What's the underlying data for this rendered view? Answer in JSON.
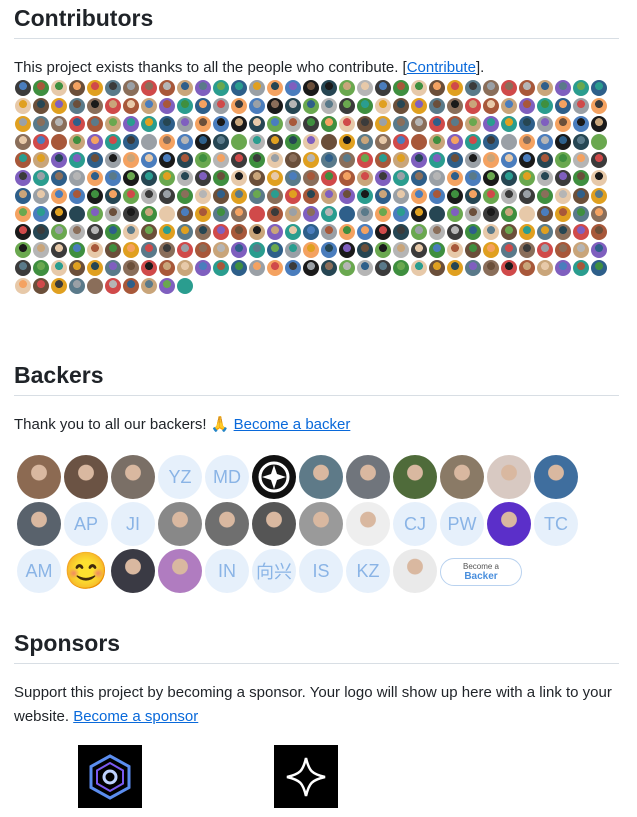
{
  "contributors": {
    "title": "Contributors",
    "text": "This project exists thanks to all the people who contribute. [",
    "link": "Contribute",
    "text_end": "].",
    "avatar_count": 373
  },
  "backers": {
    "title": "Backers",
    "text": "Thank you to all our backers! 🙏 ",
    "link": "Become a backer",
    "items": [
      {
        "type": "photo",
        "color": "#8c6a52"
      },
      {
        "type": "photo",
        "color": "#6b5344"
      },
      {
        "type": "photo",
        "color": "#7a6f66"
      },
      {
        "type": "initials",
        "text": "YZ"
      },
      {
        "type": "initials",
        "text": "MD"
      },
      {
        "type": "logo",
        "color": "#111111"
      },
      {
        "type": "photo",
        "color": "#5e7a88"
      },
      {
        "type": "photo",
        "color": "#70757c"
      },
      {
        "type": "photo",
        "color": "#4f6b3a"
      },
      {
        "type": "photo",
        "color": "#8a7a66"
      },
      {
        "type": "photo",
        "color": "#d8c9c2"
      },
      {
        "type": "photo",
        "color": "#3f6e9e"
      },
      {
        "type": "photo",
        "color": "#59626c"
      },
      {
        "type": "initials",
        "text": "AP"
      },
      {
        "type": "initials",
        "text": "JI"
      },
      {
        "type": "photo",
        "color": "#888888"
      },
      {
        "type": "photo",
        "color": "#6f6f6f"
      },
      {
        "type": "photo",
        "color": "#555555"
      },
      {
        "type": "photo",
        "color": "#9a9a9a"
      },
      {
        "type": "photo",
        "color": "#eeeeee"
      },
      {
        "type": "initials",
        "text": "CJ"
      },
      {
        "type": "initials",
        "text": "PW"
      },
      {
        "type": "photo",
        "color": "#5b2fc9"
      },
      {
        "type": "initials",
        "text": "TC"
      },
      {
        "type": "initials",
        "text": "AM"
      },
      {
        "type": "emoji",
        "text": "😊"
      },
      {
        "type": "photo",
        "color": "#3a3a44"
      },
      {
        "type": "photo",
        "color": "#b07cc0"
      },
      {
        "type": "initials",
        "text": "IN"
      },
      {
        "type": "initials",
        "text": "向兴"
      },
      {
        "type": "initials",
        "text": "IS"
      },
      {
        "type": "initials",
        "text": "KZ"
      },
      {
        "type": "photo",
        "color": "#eaeaea"
      }
    ],
    "button_line1": "Become a",
    "button_line2": "Backer"
  },
  "sponsors": {
    "title": "Sponsors",
    "text": "Support this project by becoming a sponsor. Your logo will show up here with a link to your website. ",
    "link": "Become a sponsor"
  },
  "colors": {
    "link": "#0969da",
    "palette": [
      "#3b3b3b",
      "#6b4f3a",
      "#8a6e5a",
      "#c9a57a",
      "#2e5f8a",
      "#4a7dbd",
      "#6aa84f",
      "#3f8f3f",
      "#e0a020",
      "#d04a4a",
      "#7f5fbf",
      "#9aa0a6",
      "#1a1a1a",
      "#b5b5b5",
      "#e7c9a9",
      "#5a7a8a",
      "#a8583a",
      "#2a9d8f",
      "#f4a261",
      "#264653"
    ]
  }
}
